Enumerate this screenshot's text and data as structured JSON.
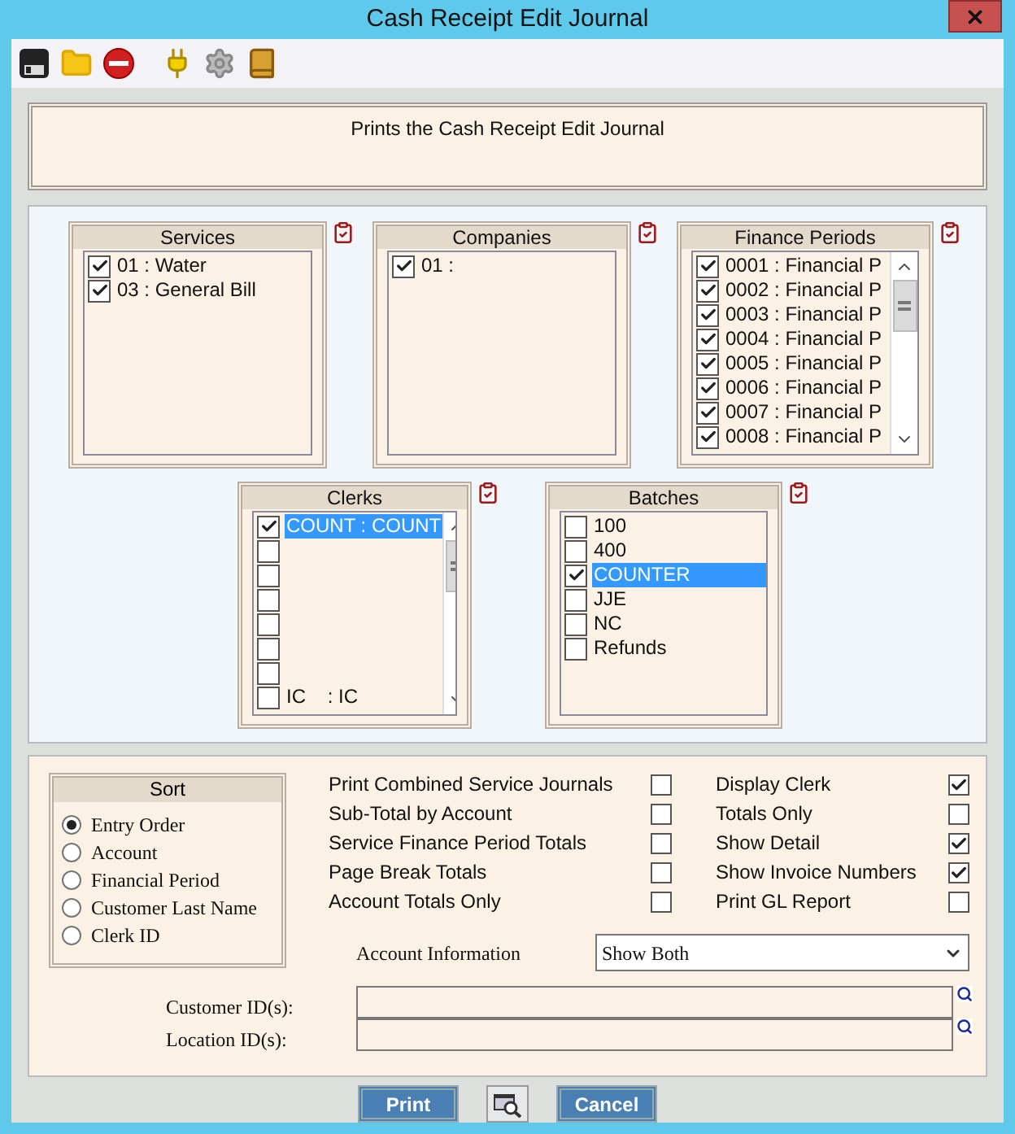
{
  "window": {
    "title": "Cash Receipt Edit Journal"
  },
  "description": "Prints the Cash Receipt Edit Journal",
  "list_rows": [
    [
      {
        "title": "Services",
        "scrollbar": false,
        "items": [
          {
            "label": "01 : Water",
            "checked": true,
            "selected": false
          },
          {
            "label": "03 : General Bill",
            "checked": true,
            "selected": false
          }
        ]
      },
      {
        "title": "Companies",
        "scrollbar": false,
        "items": [
          {
            "label": "01 :",
            "checked": true,
            "selected": false
          }
        ]
      },
      {
        "title": "Finance Periods",
        "scrollbar": true,
        "items": [
          {
            "label": "0001 : Financial P",
            "checked": true,
            "selected": false
          },
          {
            "label": "0002 : Financial P",
            "checked": true,
            "selected": false
          },
          {
            "label": "0003 : Financial P",
            "checked": true,
            "selected": false
          },
          {
            "label": "0004 : Financial P",
            "checked": true,
            "selected": false
          },
          {
            "label": "0005 : Financial P",
            "checked": true,
            "selected": false
          },
          {
            "label": "0006 : Financial P",
            "checked": true,
            "selected": false
          },
          {
            "label": "0007 : Financial P",
            "checked": true,
            "selected": false
          },
          {
            "label": "0008 : Financial P",
            "checked": true,
            "selected": false
          }
        ]
      }
    ],
    [
      {
        "title": "Clerks",
        "scrollbar": true,
        "items": [
          {
            "label": "COUNT : COUNT",
            "checked": true,
            "selected": true
          },
          {
            "checked": false
          },
          {
            "checked": false
          },
          {
            "checked": false
          },
          {
            "checked": false
          },
          {
            "checked": false
          },
          {
            "checked": false
          },
          {
            "label": "IC    : IC",
            "checked": false,
            "selected": false
          }
        ]
      },
      {
        "title": "Batches",
        "scrollbar": false,
        "items": [
          {
            "label": "100",
            "checked": false,
            "selected": false
          },
          {
            "label": "400",
            "checked": false,
            "selected": false
          },
          {
            "label": "COUNTER",
            "checked": true,
            "selected": true
          },
          {
            "label": "JJE",
            "checked": false,
            "selected": false
          },
          {
            "label": "NC",
            "checked": false,
            "selected": false
          },
          {
            "label": "Refunds",
            "checked": false,
            "selected": false
          }
        ]
      }
    ]
  ],
  "sort": {
    "title": "Sort",
    "options": [
      {
        "label": "Entry Order",
        "selected": true
      },
      {
        "label": "Account",
        "selected": false
      },
      {
        "label": "Financial Period",
        "selected": false
      },
      {
        "label": "Customer Last Name",
        "selected": false
      },
      {
        "label": "Clerk ID",
        "selected": false
      }
    ]
  },
  "options_left": [
    {
      "label": "Print Combined Service Journals",
      "checked": false
    },
    {
      "label": "Sub-Total by Account",
      "checked": false
    },
    {
      "label": "Service Finance Period Totals",
      "checked": false
    },
    {
      "label": "Page Break Totals",
      "checked": false
    },
    {
      "label": "Account Totals Only",
      "checked": false
    }
  ],
  "options_right": [
    {
      "label": "Display Clerk",
      "checked": true
    },
    {
      "label": "Totals Only",
      "checked": false
    },
    {
      "label": "Show Detail",
      "checked": true
    },
    {
      "label": "Show Invoice Numbers",
      "checked": true
    },
    {
      "label": "Print GL Report",
      "checked": false
    }
  ],
  "account_information": {
    "label": "Account Information",
    "value": "Show Both"
  },
  "id_fields": [
    {
      "label": "Customer ID(s):"
    },
    {
      "label": "Location ID(s):"
    }
  ],
  "buttons": [
    {
      "kind": "text",
      "label": "Print"
    },
    {
      "kind": "preview"
    },
    {
      "kind": "text",
      "label": "Cancel"
    }
  ]
}
